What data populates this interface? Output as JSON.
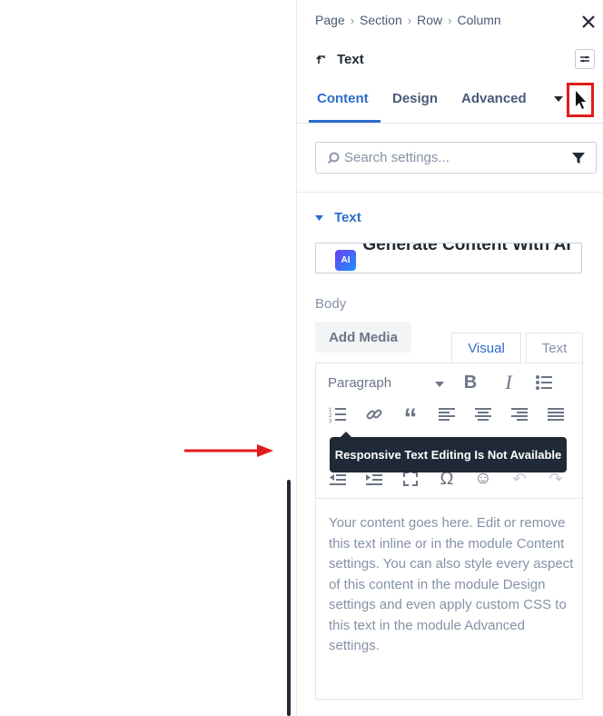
{
  "breadcrumb": [
    "Page",
    "Section",
    "Row",
    "Column"
  ],
  "module": {
    "name": "Text"
  },
  "tabs": [
    {
      "label": "Content",
      "active": true
    },
    {
      "label": "Design",
      "active": false
    },
    {
      "label": "Advanced",
      "active": false
    }
  ],
  "search": {
    "placeholder": "Search settings...",
    "value": ""
  },
  "section": {
    "title": "Text"
  },
  "ai_button": {
    "badge": "AI",
    "label": "Generate Content With AI"
  },
  "body": {
    "label": "Body",
    "add_media": "Add Media"
  },
  "editor_tabs": {
    "visual": "Visual",
    "text": "Text"
  },
  "toolbar": {
    "format_select": "Paragraph"
  },
  "tooltip": "Responsive Text Editing Is Not Available",
  "content": "Your content goes here. Edit or remove this text inline or in the module Content settings. You can also style every aspect of this content in the module Design settings and even apply custom CSS to this text in the module Advanced settings.",
  "colors": {
    "accent": "#2c6ccb",
    "highlight": "#e11b1b",
    "tooltip_bg": "#1f2937",
    "arrow": "#e11b1b"
  }
}
